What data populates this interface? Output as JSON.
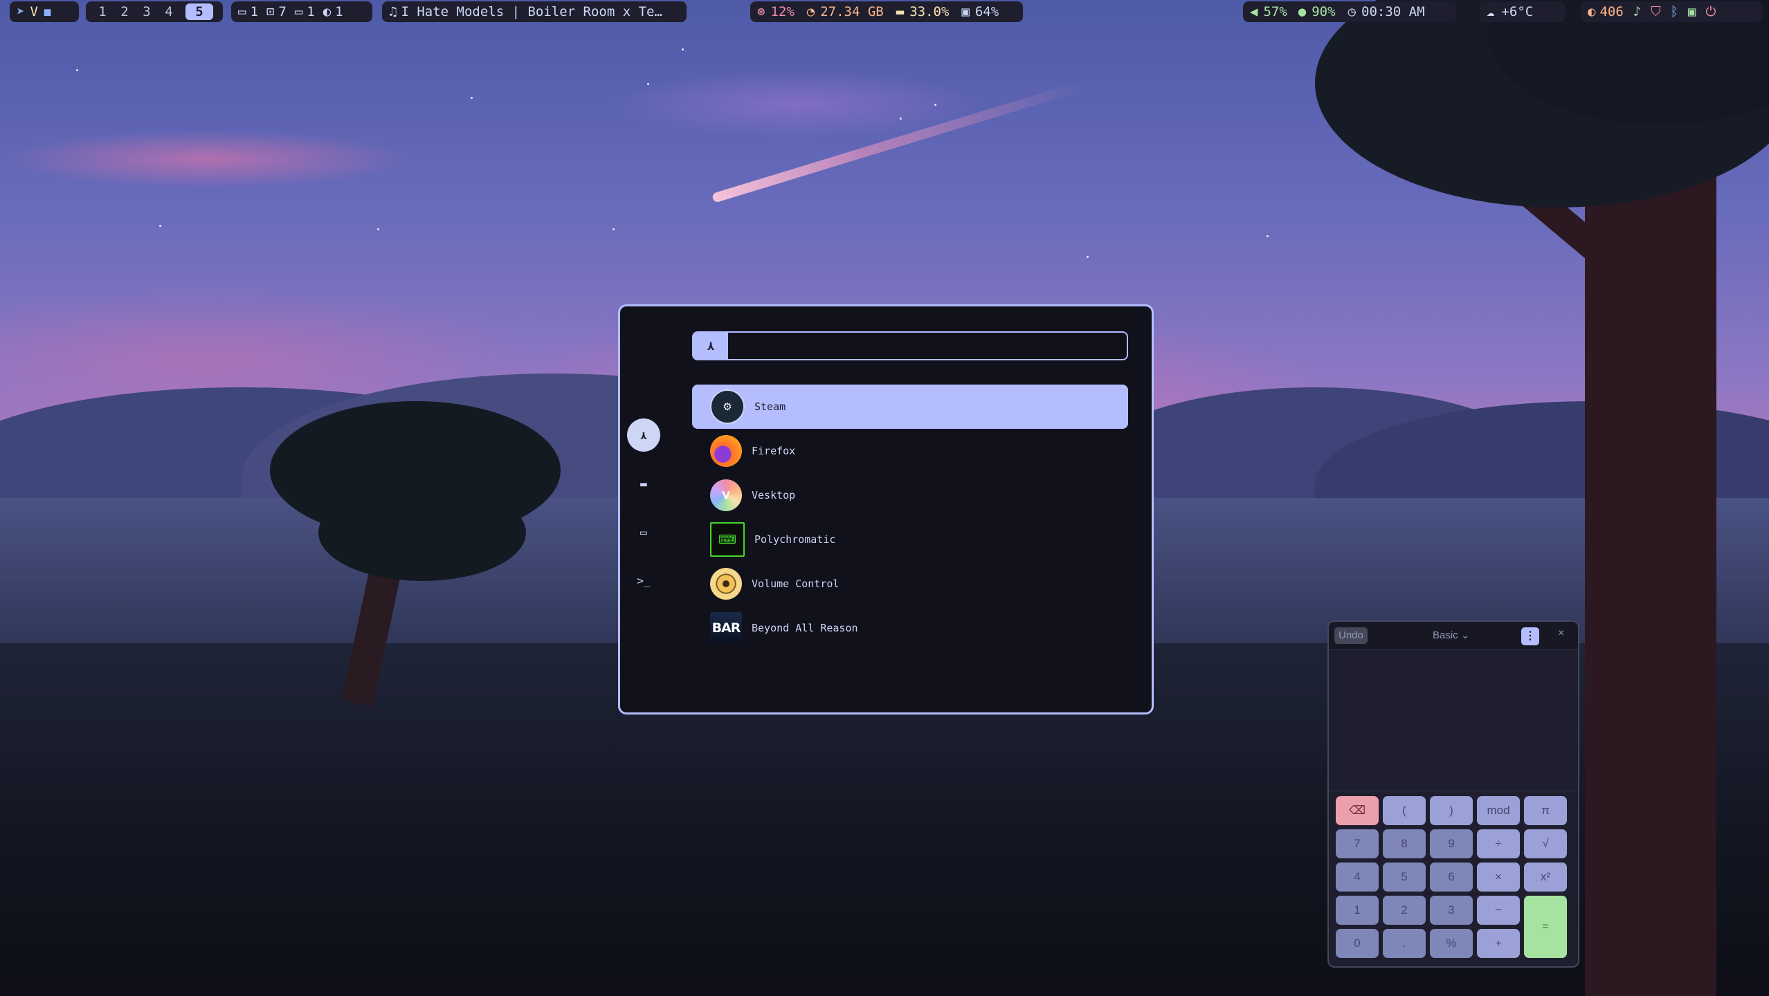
{
  "topbar": {
    "workspaces": [
      "1",
      "2",
      "3",
      "4",
      "5"
    ],
    "active_workspace": "5",
    "window_counts": [
      {
        "icon": "window-icon",
        "count": "1"
      },
      {
        "icon": "terminal-window-icon",
        "count": "7"
      },
      {
        "icon": "window-icon",
        "count": "1"
      },
      {
        "icon": "half-circle-icon",
        "count": "1"
      }
    ],
    "now_playing": "I Hate Models | Boiler Room x Te…",
    "cpu": "12%",
    "memory": "27.34 GB",
    "gpu": "33.0%",
    "disk": "64%",
    "volume": "57%",
    "mic": "90%",
    "clock": "00:30 AM",
    "temperature": "+6°C",
    "updates": "406"
  },
  "launcher": {
    "search_prefix": "⋏",
    "search_value": "",
    "results": [
      {
        "label": "Steam",
        "icon": "steam-icon",
        "selected": true
      },
      {
        "label": "Firefox",
        "icon": "firefox-icon"
      },
      {
        "label": "Vesktop",
        "icon": "vesktop-icon"
      },
      {
        "label": "Polychromatic",
        "icon": "polychromatic-icon"
      },
      {
        "label": "Volume Control",
        "icon": "volume-control-icon"
      },
      {
        "label": "Beyond All Reason",
        "icon": "bar-icon",
        "icon_text": "BAR"
      }
    ]
  },
  "calculator": {
    "undo_label": "Undo",
    "mode_label": "Basic ⌄",
    "menu_label": "⋮",
    "close_label": "×",
    "keys": {
      "backspace": "⌫",
      "lparen": "(",
      "rparen": ")",
      "mod": "mod",
      "pi": "π",
      "k7": "7",
      "k8": "8",
      "k9": "9",
      "div": "÷",
      "sqrt": "√",
      "k4": "4",
      "k5": "5",
      "k6": "6",
      "mul": "×",
      "sq": "x²",
      "k1": "1",
      "k2": "2",
      "k3": "3",
      "sub": "−",
      "eq": "=",
      "k0": "0",
      "dot": ".",
      "pct": "%",
      "add": "+"
    }
  },
  "colors": {
    "accent": "#b4befe",
    "background": "#11111b",
    "equals_key": "#a6e3a1",
    "backspace_key": "#eba0ac"
  }
}
